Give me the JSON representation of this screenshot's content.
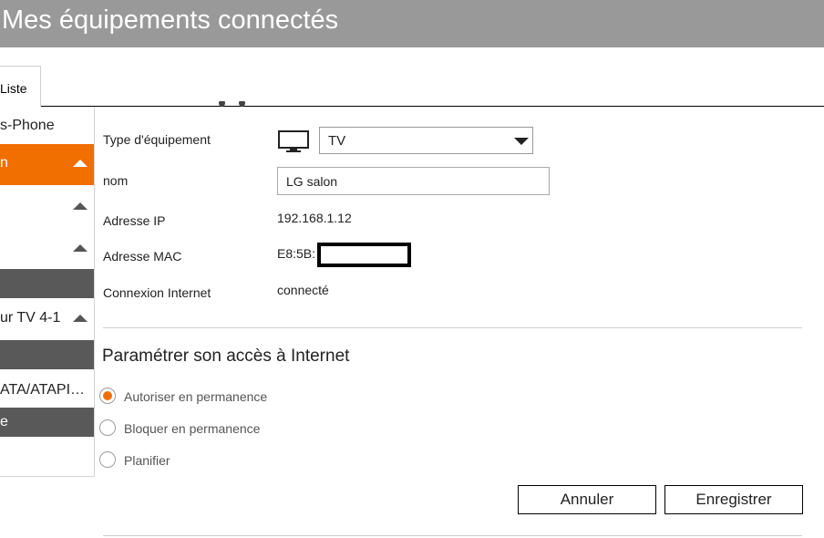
{
  "header": {
    "title": "Mes équipements connectés"
  },
  "tabs": {
    "list_label": "Liste"
  },
  "sidebar": {
    "items": [
      {
        "label": "s-Phone",
        "style": "plain",
        "arrow": false
      },
      {
        "label": "n",
        "style": "orange",
        "arrow": true
      },
      {
        "label": "",
        "style": "plain",
        "arrow": true
      },
      {
        "label": "",
        "style": "plain",
        "arrow": true
      },
      {
        "label": "",
        "style": "dark",
        "arrow": false
      },
      {
        "label": "ur TV 4-1",
        "style": "plain",
        "arrow": true
      },
      {
        "label": "",
        "style": "dark",
        "arrow": false
      },
      {
        "label": "ATA/ATAPI…",
        "style": "plain",
        "arrow": false
      },
      {
        "label": "e",
        "style": "dark",
        "arrow": false
      }
    ]
  },
  "details": {
    "type_label": "Type d'équipement",
    "type_icon": "tv-icon",
    "type_value": "TV",
    "name_label": "nom",
    "name_value": "LG salon",
    "ip_label": "Adresse IP",
    "ip_value": "192.168.1.12",
    "mac_label": "Adresse MAC",
    "mac_value": "E8:5B:",
    "connection_label": "Connexion Internet",
    "connection_value": "connecté"
  },
  "access": {
    "title": "Paramétrer son accès à Internet",
    "options": [
      {
        "label": "Autoriser en permanence",
        "checked": true
      },
      {
        "label": "Bloquer en permanence",
        "checked": false
      },
      {
        "label": "Planifier",
        "checked": false
      }
    ]
  },
  "buttons": {
    "cancel": "Annuler",
    "save": "Enregistrer"
  },
  "colors": {
    "accent": "#f16e00",
    "header": "#999999",
    "sidebar_dark": "#595959"
  }
}
